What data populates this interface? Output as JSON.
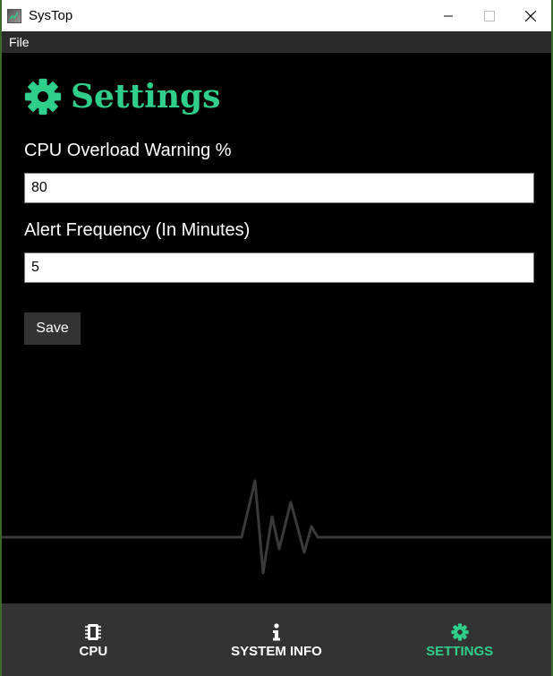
{
  "window": {
    "title": "SysTop",
    "icon": "systop-app-icon"
  },
  "menubar": {
    "items": [
      {
        "label": "File"
      }
    ]
  },
  "settings": {
    "heading": "Settings",
    "heading_icon": "gear-icon",
    "cpu_overload_label": "CPU Overload Warning %",
    "cpu_overload_value": "80",
    "alert_frequency_label": "Alert Frequency (In Minutes)",
    "alert_frequency_value": "5",
    "save_label": "Save"
  },
  "bottom_nav": {
    "items": [
      {
        "label": "CPU",
        "icon": "microchip-icon",
        "active": false
      },
      {
        "label": "SYSTEM INFO",
        "icon": "info-icon",
        "active": false
      },
      {
        "label": "SETTINGS",
        "icon": "gear-icon",
        "active": true
      }
    ]
  },
  "colors": {
    "accent": "#2fce8a",
    "background": "#000000",
    "nav_background": "#333333",
    "menubar_background": "#2b2b2b"
  }
}
